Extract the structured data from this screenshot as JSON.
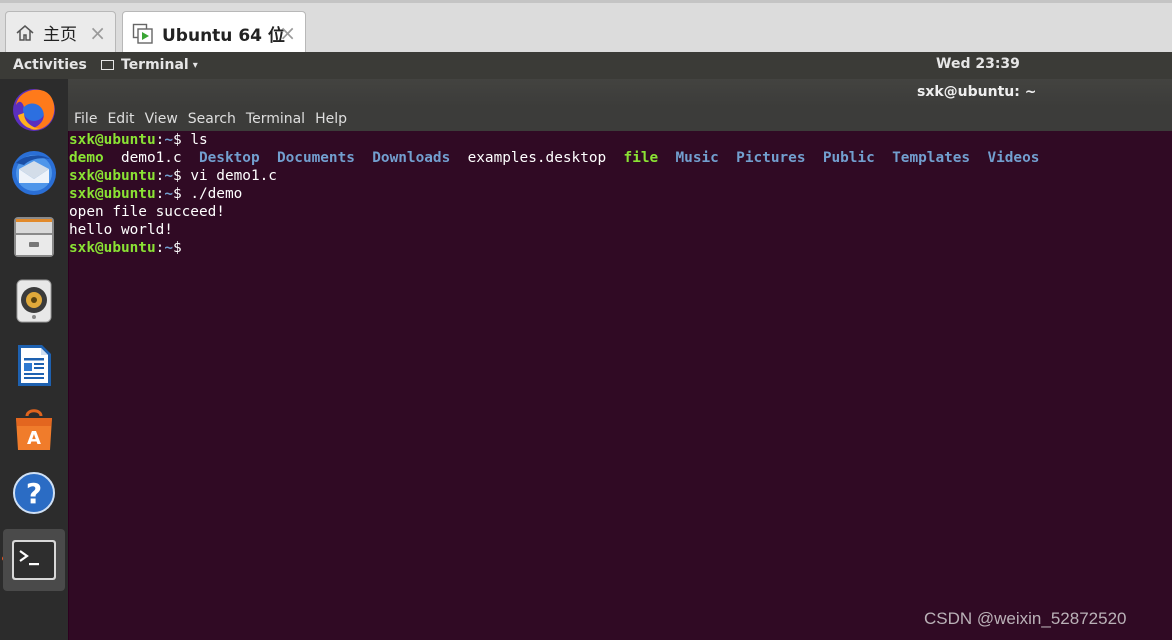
{
  "vm_tabs": [
    {
      "label": "主页",
      "icon": "home-icon",
      "close": "×"
    },
    {
      "label": "Ubuntu 64 位",
      "icon": "vm-icon",
      "close": "×"
    }
  ],
  "topbar": {
    "activities": "Activities",
    "app_menu": "Terminal",
    "caret": "▾",
    "clock": "Wed 23:39"
  },
  "dock": {
    "items": [
      "firefox-icon",
      "thunderbird-icon",
      "files-icon",
      "rhythmbox-icon",
      "writer-icon",
      "software-icon",
      "help-icon",
      "terminal-icon"
    ],
    "active_item": "terminal-icon"
  },
  "terminal": {
    "title": "sxk@ubuntu: ~",
    "menu": [
      "File",
      "Edit",
      "View",
      "Search",
      "Terminal",
      "Help"
    ],
    "prompt_user": "sxk@ubuntu",
    "prompt_path": "~",
    "prompt_sep": ":",
    "prompt_tail": "$ ",
    "commands": [
      "ls",
      "vi demo1.c",
      "./demo",
      ""
    ],
    "ls_output": [
      {
        "name": "demo",
        "kind": "exec",
        "pad": "  "
      },
      {
        "name": "demo1.c",
        "kind": "plain",
        "pad": "  "
      },
      {
        "name": "Desktop",
        "kind": "dir",
        "pad": "  "
      },
      {
        "name": "Documents",
        "kind": "dir",
        "pad": "  "
      },
      {
        "name": "Downloads",
        "kind": "dir",
        "pad": "  "
      },
      {
        "name": "examples.desktop",
        "kind": "plain",
        "pad": "  "
      },
      {
        "name": "file",
        "kind": "exec",
        "pad": "  "
      },
      {
        "name": "Music",
        "kind": "dir",
        "pad": "  "
      },
      {
        "name": "Pictures",
        "kind": "dir",
        "pad": "  "
      },
      {
        "name": "Public",
        "kind": "dir",
        "pad": "  "
      },
      {
        "name": "Templates",
        "kind": "dir",
        "pad": "  "
      },
      {
        "name": "Videos",
        "kind": "dir",
        "pad": ""
      }
    ],
    "program_output": [
      "open file succeed!",
      "hello world!"
    ],
    "colors": {
      "background": "#300a24",
      "prompt_user": "#8ae234",
      "prompt_path": "#729fcf",
      "dir": "#729fcf",
      "exec": "#8ae234"
    }
  },
  "watermark": "CSDN @weixin_52872520"
}
